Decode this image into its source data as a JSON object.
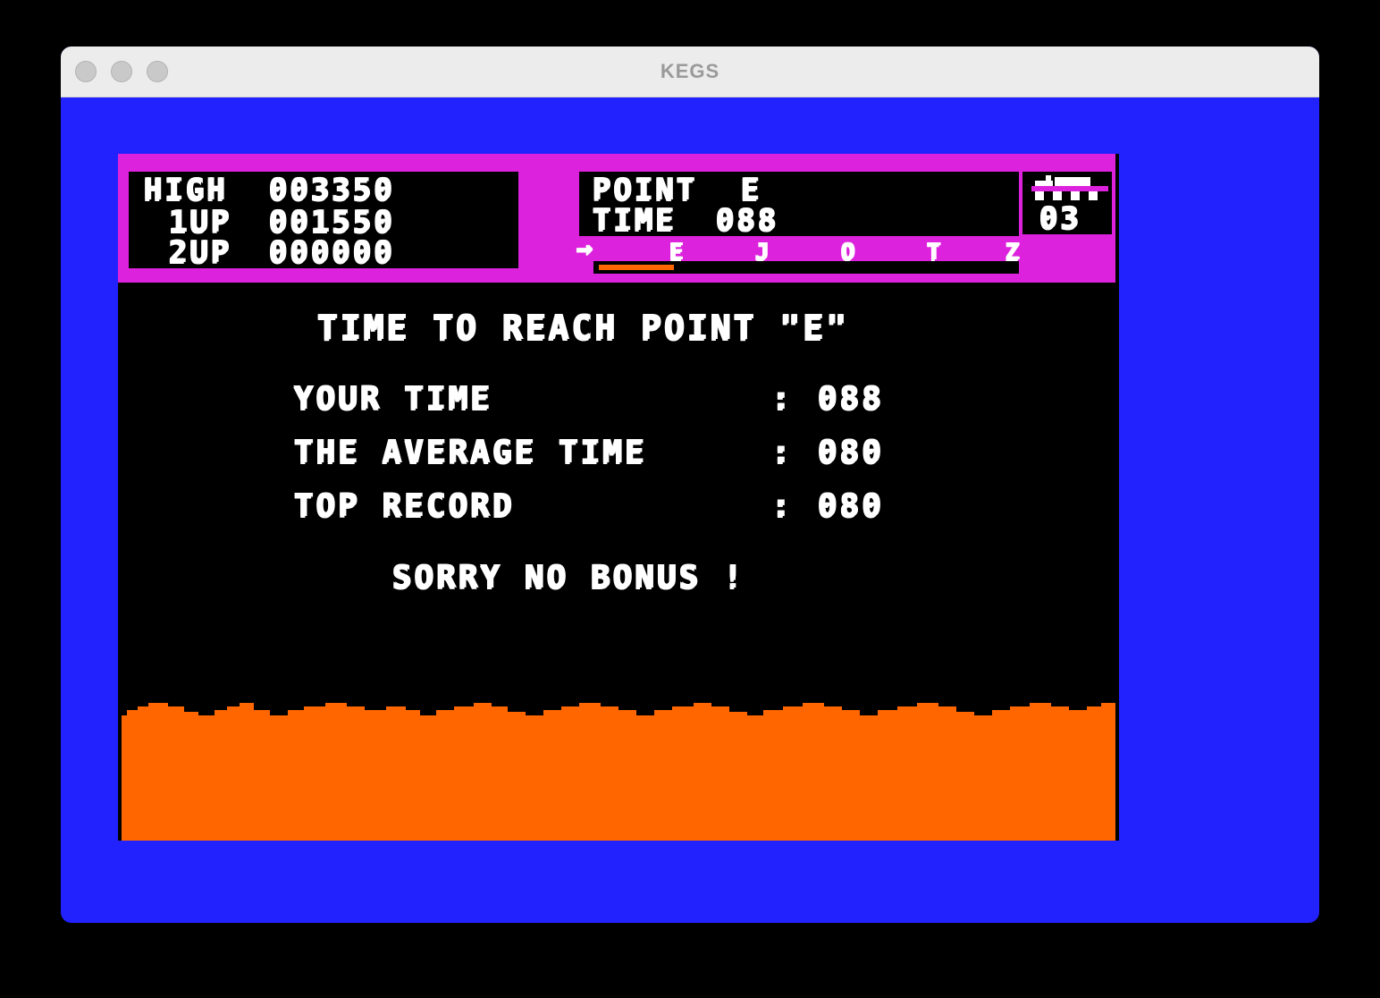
{
  "window": {
    "title": "KEGS"
  },
  "hud": {
    "scores": [
      {
        "label": "HIGH",
        "value": "003350"
      },
      {
        "label": "1UP",
        "value": "001550"
      },
      {
        "label": "2UP",
        "value": "000000"
      }
    ],
    "point_label": "POINT",
    "point_value": "E",
    "time_label": "TIME",
    "time_value": "088",
    "lives": "03",
    "course_marker": "→",
    "course_points": [
      "E",
      "J",
      "O",
      "T",
      "Z"
    ],
    "progress_fraction": 0.18
  },
  "results": {
    "heading": "TIME TO REACH POINT \"E\"",
    "rows": [
      {
        "label": "YOUR TIME",
        "sep": ":",
        "value": "088"
      },
      {
        "label": "THE AVERAGE TIME",
        "sep": ":",
        "value": "080"
      },
      {
        "label": "TOP RECORD",
        "sep": ":",
        "value": "080"
      }
    ],
    "message": "SORRY NO BONUS !"
  },
  "colors": {
    "background": "#2222ff",
    "hud": "#dd22dd",
    "ground": "#ff6600",
    "text": "#ffffff"
  }
}
